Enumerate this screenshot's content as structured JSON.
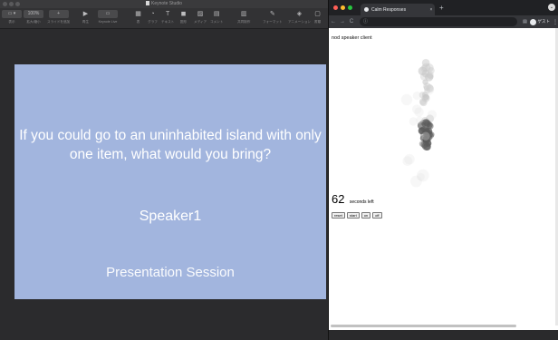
{
  "keynote": {
    "window_title": "Keynote Studio",
    "toolbar": [
      {
        "glyph": "▭ ▾",
        "label": "表示",
        "wide": true
      },
      {
        "glyph": "100%",
        "label": "拡大/縮小",
        "wide": true
      },
      {
        "glyph": "+",
        "label": "スライドを追加",
        "wide": true
      },
      {
        "glyph": "▶",
        "label": "再生",
        "wide": false
      },
      {
        "glyph": "▭",
        "label": "Keynote Live",
        "wide": true
      },
      {
        "glyph": "▦",
        "label": "表",
        "wide": false
      },
      {
        "glyph": "◔",
        "label": "グラフ",
        "wide": false
      },
      {
        "glyph": "T",
        "label": "テキスト",
        "wide": false
      },
      {
        "glyph": "◼",
        "label": "図形",
        "wide": false
      },
      {
        "glyph": "▨",
        "label": "メディア",
        "wide": false
      },
      {
        "glyph": "▤",
        "label": "コメント",
        "wide": false
      },
      {
        "glyph": "▥",
        "label": "共同制作",
        "wide": false
      },
      {
        "glyph": "✎",
        "label": "フォーマット",
        "wide": false
      },
      {
        "glyph": "◈",
        "label": "アニメーション",
        "wide": false
      },
      {
        "glyph": "▢",
        "label": "書類",
        "wide": false
      }
    ],
    "slide": {
      "question": "If you could go to an uninhabited island with only one item, what would you bring?",
      "speaker": "Speaker1",
      "session": "Presentation Session"
    }
  },
  "chrome": {
    "tab_title": "Calm Responses",
    "tab_close": "×",
    "new_tab": "+",
    "url": "ⓘ",
    "extension": "▤",
    "profile_label": "ゲスト",
    "menu": "⋮",
    "nav": {
      "back": "←",
      "forward": "→",
      "reload": "C"
    },
    "content": {
      "app_title": "nod speaker client",
      "seconds": "62",
      "seconds_suffix": "seconds left",
      "buttons": [
        "reset",
        "start",
        "on",
        "off"
      ]
    }
  },
  "colors": {
    "slide_bg": "#a2b5de",
    "keynote_bg": "#2b2b2d",
    "chrome_frame": "#202124",
    "traffic_red": "#ff5f57",
    "traffic_yellow": "#febc2e",
    "traffic_green": "#28c840"
  }
}
